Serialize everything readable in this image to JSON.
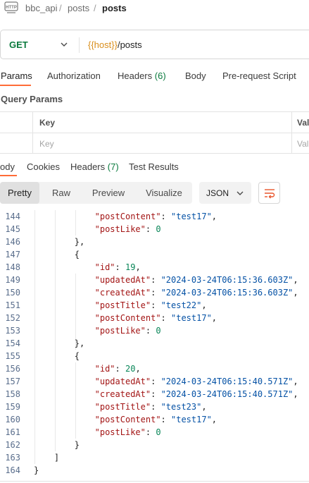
{
  "breadcrumb": {
    "icon": "http-icon",
    "items": [
      "bbc_api",
      "posts",
      "posts"
    ]
  },
  "request": {
    "method": "GET",
    "url_var": "{{host}}",
    "url_path": "/posts"
  },
  "request_tabs": [
    {
      "label": "Params",
      "count": ""
    },
    {
      "label": "Authorization",
      "count": ""
    },
    {
      "label": "Headers",
      "count": "(6)"
    },
    {
      "label": "Body",
      "count": ""
    },
    {
      "label": "Pre-request Script",
      "count": ""
    }
  ],
  "query_params": {
    "title": "Query Params",
    "key_header": "Key",
    "value_header": "Val",
    "key_placeholder": "Key",
    "value_placeholder": "Val"
  },
  "response_tabs": [
    {
      "label": "ody",
      "count": ""
    },
    {
      "label": "Cookies",
      "count": ""
    },
    {
      "label": "Headers",
      "count": "(7)"
    },
    {
      "label": "Test Results",
      "count": ""
    }
  ],
  "view_modes": [
    "Pretty",
    "Raw",
    "Preview",
    "Visualize"
  ],
  "format": "JSON",
  "colors": {
    "accent": "#ff6c37",
    "method": "#0b7a3e",
    "variable": "#d98e1b"
  },
  "code": [
    {
      "ln": "144",
      "ind": 12,
      "parts": [
        [
          "k",
          "\"postContent\""
        ],
        [
          "p",
          ": "
        ],
        [
          "s",
          "\"test17\""
        ],
        [
          "p",
          ","
        ]
      ]
    },
    {
      "ln": "145",
      "ind": 12,
      "parts": [
        [
          "k",
          "\"postLike\""
        ],
        [
          "p",
          ": "
        ],
        [
          "n",
          "0"
        ]
      ]
    },
    {
      "ln": "146",
      "ind": 8,
      "parts": [
        [
          "p",
          "},"
        ]
      ]
    },
    {
      "ln": "147",
      "ind": 8,
      "parts": [
        [
          "p",
          "{"
        ]
      ]
    },
    {
      "ln": "148",
      "ind": 12,
      "parts": [
        [
          "k",
          "\"id\""
        ],
        [
          "p",
          ": "
        ],
        [
          "n",
          "19"
        ],
        [
          "p",
          ","
        ]
      ]
    },
    {
      "ln": "149",
      "ind": 12,
      "parts": [
        [
          "k",
          "\"updatedAt\""
        ],
        [
          "p",
          ": "
        ],
        [
          "s",
          "\"2024-03-24T06:15:36.603Z\""
        ],
        [
          "p",
          ","
        ]
      ]
    },
    {
      "ln": "150",
      "ind": 12,
      "parts": [
        [
          "k",
          "\"createdAt\""
        ],
        [
          "p",
          ": "
        ],
        [
          "s",
          "\"2024-03-24T06:15:36.603Z\""
        ],
        [
          "p",
          ","
        ]
      ]
    },
    {
      "ln": "151",
      "ind": 12,
      "parts": [
        [
          "k",
          "\"postTitle\""
        ],
        [
          "p",
          ": "
        ],
        [
          "s",
          "\"test22\""
        ],
        [
          "p",
          ","
        ]
      ]
    },
    {
      "ln": "152",
      "ind": 12,
      "parts": [
        [
          "k",
          "\"postContent\""
        ],
        [
          "p",
          ": "
        ],
        [
          "s",
          "\"test17\""
        ],
        [
          "p",
          ","
        ]
      ]
    },
    {
      "ln": "153",
      "ind": 12,
      "parts": [
        [
          "k",
          "\"postLike\""
        ],
        [
          "p",
          ": "
        ],
        [
          "n",
          "0"
        ]
      ]
    },
    {
      "ln": "154",
      "ind": 8,
      "parts": [
        [
          "p",
          "},"
        ]
      ]
    },
    {
      "ln": "155",
      "ind": 8,
      "parts": [
        [
          "p",
          "{"
        ]
      ]
    },
    {
      "ln": "156",
      "ind": 12,
      "parts": [
        [
          "k",
          "\"id\""
        ],
        [
          "p",
          ": "
        ],
        [
          "n",
          "20"
        ],
        [
          "p",
          ","
        ]
      ]
    },
    {
      "ln": "157",
      "ind": 12,
      "parts": [
        [
          "k",
          "\"updatedAt\""
        ],
        [
          "p",
          ": "
        ],
        [
          "s",
          "\"2024-03-24T06:15:40.571Z\""
        ],
        [
          "p",
          ","
        ]
      ]
    },
    {
      "ln": "158",
      "ind": 12,
      "parts": [
        [
          "k",
          "\"createdAt\""
        ],
        [
          "p",
          ": "
        ],
        [
          "s",
          "\"2024-03-24T06:15:40.571Z\""
        ],
        [
          "p",
          ","
        ]
      ]
    },
    {
      "ln": "159",
      "ind": 12,
      "parts": [
        [
          "k",
          "\"postTitle\""
        ],
        [
          "p",
          ": "
        ],
        [
          "s",
          "\"test23\""
        ],
        [
          "p",
          ","
        ]
      ]
    },
    {
      "ln": "160",
      "ind": 12,
      "parts": [
        [
          "k",
          "\"postContent\""
        ],
        [
          "p",
          ": "
        ],
        [
          "s",
          "\"test17\""
        ],
        [
          "p",
          ","
        ]
      ]
    },
    {
      "ln": "161",
      "ind": 12,
      "parts": [
        [
          "k",
          "\"postLike\""
        ],
        [
          "p",
          ": "
        ],
        [
          "n",
          "0"
        ]
      ]
    },
    {
      "ln": "162",
      "ind": 8,
      "parts": [
        [
          "p",
          "}"
        ]
      ]
    },
    {
      "ln": "163",
      "ind": 4,
      "parts": [
        [
          "p",
          "]"
        ]
      ]
    },
    {
      "ln": "164",
      "ind": 0,
      "parts": [
        [
          "p",
          "}"
        ]
      ]
    }
  ]
}
